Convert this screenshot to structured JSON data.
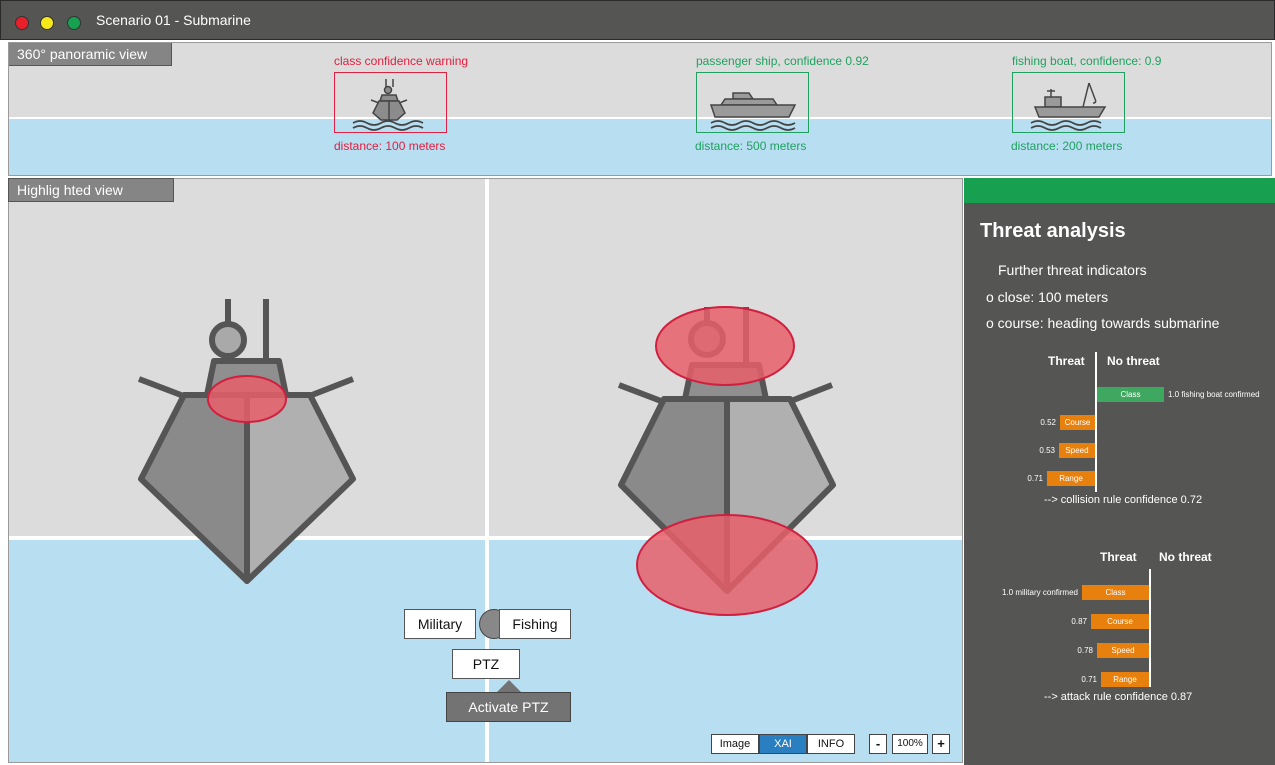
{
  "window": {
    "title": "Scenario 01 - Submarine",
    "controls": [
      {
        "name": "close",
        "color": "#e8202c"
      },
      {
        "name": "minimize",
        "color": "#f7e81a"
      },
      {
        "name": "maximize",
        "color": "#16a050"
      }
    ]
  },
  "panoramic": {
    "label": "360° panoramic view",
    "detections": [
      {
        "label": "class confidence warning",
        "distance": "distance: 100 meters",
        "icon": "warship-icon",
        "color": "#e02040"
      },
      {
        "label": "passenger ship, confidence 0.92",
        "distance": "distance: 500 meters",
        "icon": "passenger-ship-icon",
        "color": "#20a060"
      },
      {
        "label": "fishing boat, confidence: 0.9",
        "distance": "distance: 200 meters",
        "icon": "fishing-boat-icon",
        "color": "#20a060"
      }
    ]
  },
  "highlighted": {
    "label": "Highlig hted view",
    "toggle": {
      "left": "Military",
      "right": "Fishing"
    },
    "ptz": "PTZ",
    "activate": "Activate PTZ",
    "modes": [
      {
        "label": "Image",
        "active": false
      },
      {
        "label": "XAI",
        "active": true
      },
      {
        "label": "INFO",
        "active": false
      }
    ],
    "zoom": {
      "minus": "-",
      "value": "100%",
      "plus": "+"
    }
  },
  "threat": {
    "title": "Threat analysis",
    "indicators_heading": "Further threat indicators",
    "indicators": [
      "o close: 100 meters",
      "o course: heading towards submarine"
    ],
    "headers": {
      "threat": "Threat",
      "no_threat": "No threat"
    },
    "collision_rule": {
      "bars": [
        {
          "name": "Class",
          "value": 1.0,
          "side": "no_threat",
          "label": "1.0 fishing boat confirmed"
        },
        {
          "name": "Course",
          "value": 0.52,
          "side": "threat",
          "label": "0.52"
        },
        {
          "name": "Speed",
          "value": 0.53,
          "side": "threat",
          "label": "0.53"
        },
        {
          "name": "Range",
          "value": 0.71,
          "side": "threat",
          "label": "0.71"
        }
      ],
      "conclusion": "--> collision rule confidence 0.72"
    },
    "attack_rule": {
      "bars": [
        {
          "name": "Class",
          "value": 1.0,
          "side": "threat",
          "label": "1.0 military confirmed"
        },
        {
          "name": "Course",
          "value": 0.87,
          "side": "threat",
          "label": "0.87"
        },
        {
          "name": "Speed",
          "value": 0.78,
          "side": "threat",
          "label": "0.78"
        },
        {
          "name": "Range",
          "value": 0.71,
          "side": "threat",
          "label": "0.71"
        }
      ],
      "conclusion": "--> attack rule confidence 0.87"
    }
  }
}
